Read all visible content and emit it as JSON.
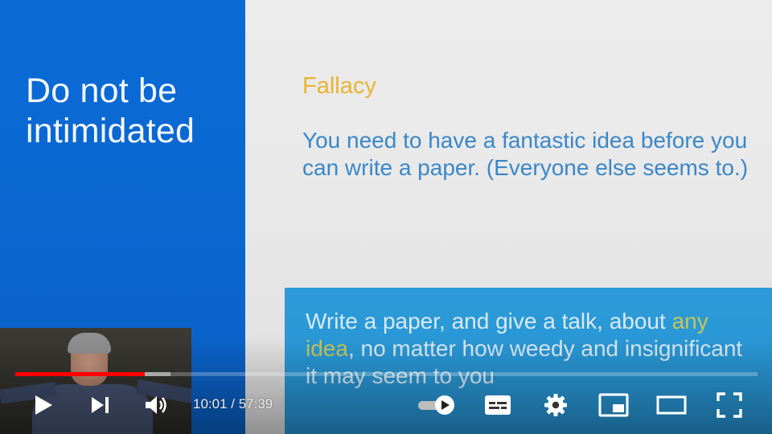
{
  "slide": {
    "title": "Do not be intimidated",
    "fallacy_label": "Fallacy",
    "fallacy_text": "You need to have a fantastic idea before you can write a paper.  (Everyone else seems to.)",
    "answer_prefix": "Write a paper, and give a talk, about",
    "answer_highlight": "any idea",
    "answer_suffix": ", no matter how weedy and insignificant it may seem to you"
  },
  "player": {
    "current_time": "10:01",
    "separator": " / ",
    "duration": "57:39",
    "played_fraction": 0.174,
    "buffered_fraction": 0.209,
    "autoplay_on": true,
    "icons": {
      "play": "play-icon",
      "next": "next-icon",
      "volume": "volume-icon",
      "autoplay": "autoplay-toggle-icon",
      "captions": "captions-icon",
      "settings": "gear-icon",
      "miniplayer": "miniplayer-icon",
      "theater": "theater-icon",
      "fullscreen": "fullscreen-icon"
    },
    "colors": {
      "progress_played": "#ff0000",
      "slide_blue": "#0a66cf",
      "fallacy_label": "#e8b431",
      "fallacy_text": "#3a87c8",
      "answer_box": "#2693d2",
      "highlight": "#c8c45a"
    }
  }
}
